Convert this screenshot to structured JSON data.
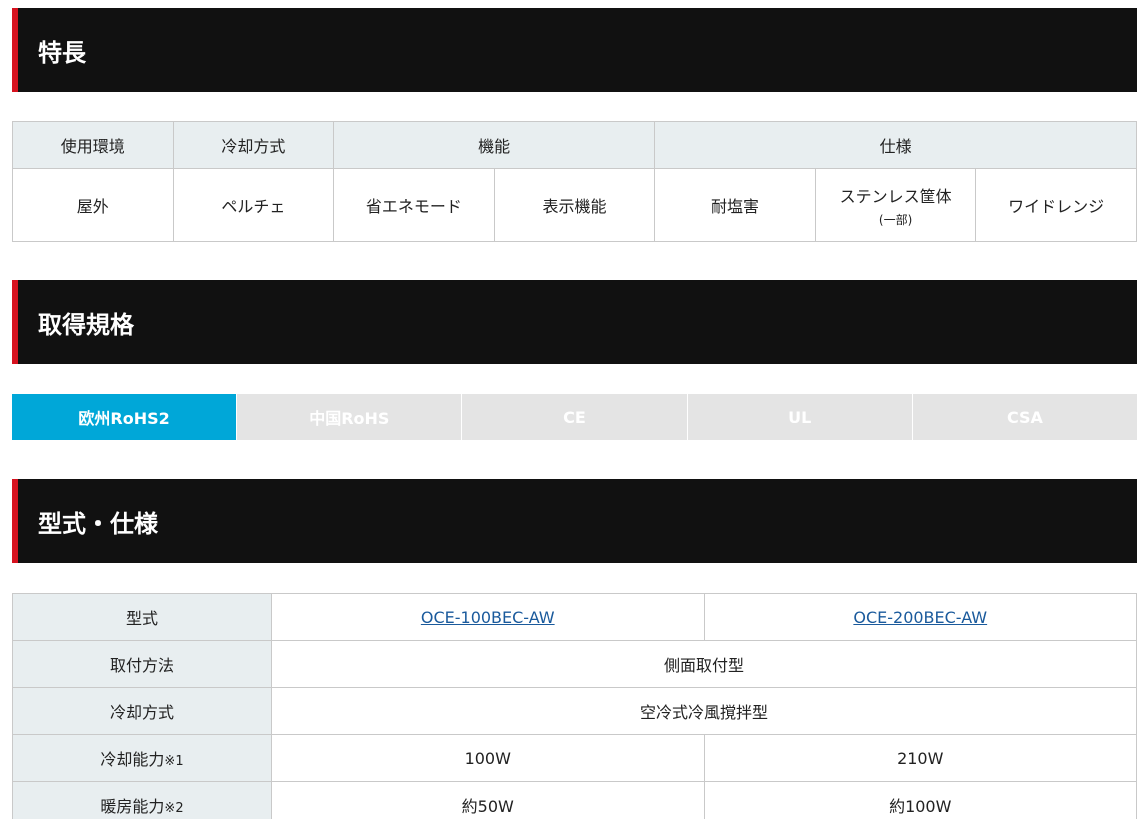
{
  "features": {
    "heading": "特長",
    "groups": [
      "使用環境",
      "冷却方式",
      "機能",
      "仕様"
    ],
    "items": [
      "屋外",
      "ペルチェ",
      "省エネモード",
      "表示機能",
      "耐塩害",
      "ステンレス筐体",
      "ワイドレンジ"
    ],
    "item_note": "(一部)"
  },
  "certs": {
    "heading": "取得規格",
    "tabs": [
      "欧州RoHS2",
      "中国RoHS",
      "CE",
      "UL",
      "CSA"
    ],
    "active": "欧州RoHS2"
  },
  "specs": {
    "heading": "型式・仕様",
    "rows": {
      "model": {
        "label": "型式",
        "values": [
          "OCE-100BEC-AW",
          "OCE-200BEC-AW"
        ]
      },
      "mount": {
        "label": "取付方法",
        "value": "側面取付型"
      },
      "cooling_method": {
        "label": "冷却方式",
        "value": "空冷式冷風撹拌型"
      },
      "cooling_capacity": {
        "label": "冷却能力",
        "note": "※1",
        "values": [
          "100W",
          "210W"
        ]
      },
      "heating_capacity": {
        "label": "暖房能力",
        "note": "※2",
        "values": [
          "約50W",
          "約100W"
        ]
      }
    }
  },
  "colors": {
    "header_bg": "#111111",
    "accent": "#d6121f",
    "tab_active": "#00a7d8",
    "tab_inactive": "#e4e4e4",
    "label_bg": "#e8eef0",
    "link": "#1a5a9c"
  }
}
